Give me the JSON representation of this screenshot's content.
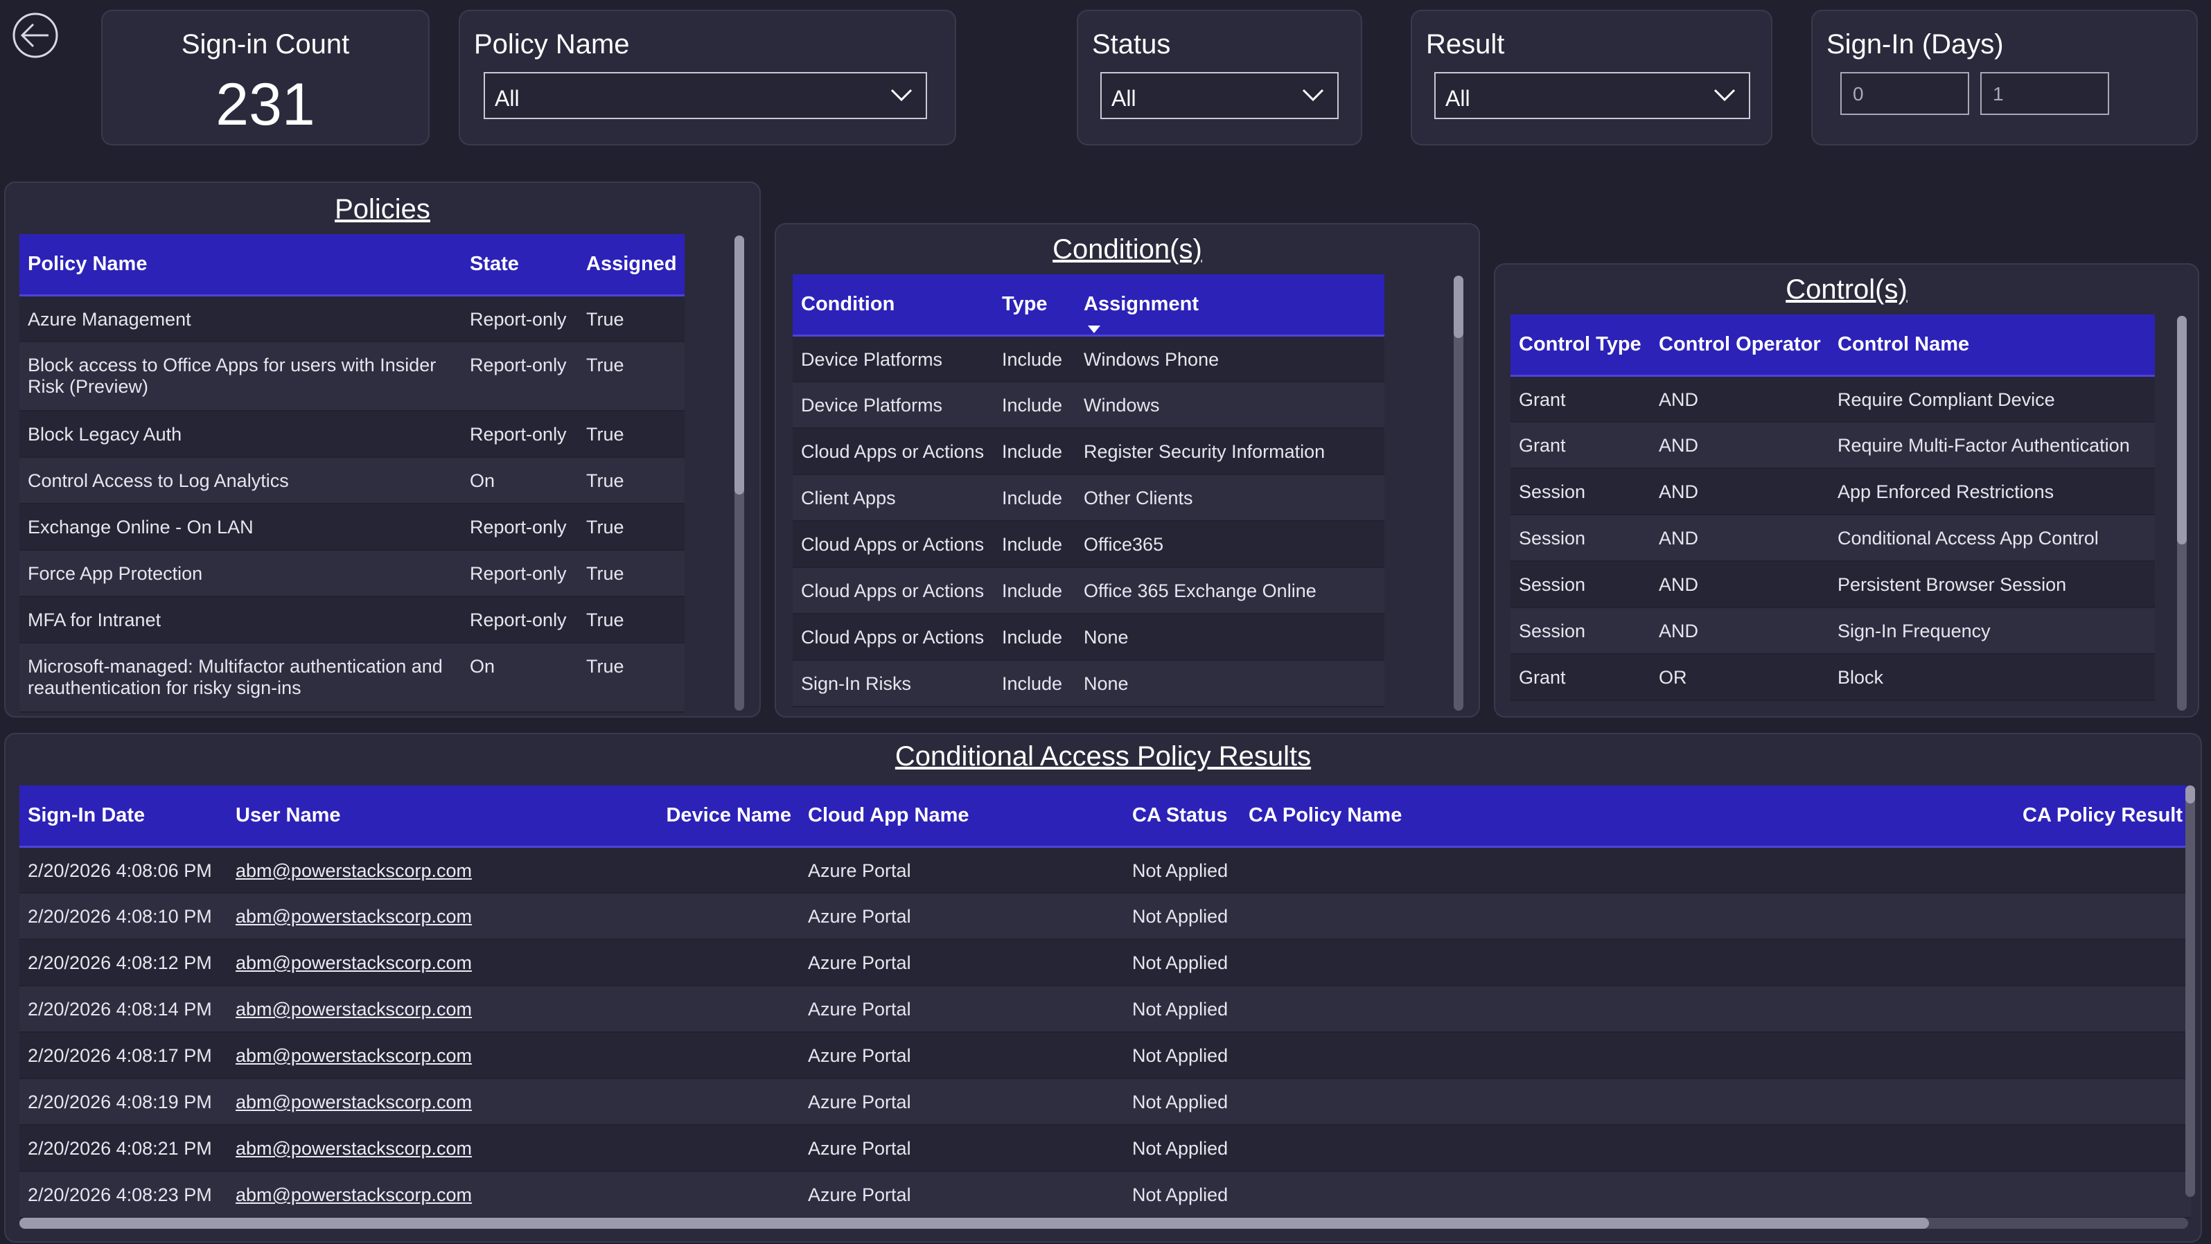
{
  "header": {
    "back_icon": "arrow-left-circle-icon",
    "sign_in_count": {
      "title": "Sign-in Count",
      "value": "231"
    },
    "policy_name_filter": {
      "title": "Policy Name",
      "selected": "All"
    },
    "status_filter": {
      "title": "Status",
      "selected": "All"
    },
    "result_filter": {
      "title": "Result",
      "selected": "All"
    },
    "sign_in_days": {
      "title": "Sign-In (Days)",
      "min": "0",
      "max": "1"
    }
  },
  "policies": {
    "title": "Policies",
    "columns": [
      "Policy Name",
      "State",
      "Assigned"
    ],
    "rows": [
      [
        "Azure Management",
        "Report-only",
        "True"
      ],
      [
        "Block access to Office Apps for users with Insider Risk (Preview)",
        "Report-only",
        "True"
      ],
      [
        "Block Legacy Auth",
        "Report-only",
        "True"
      ],
      [
        "Control Access to Log Analytics",
        "On",
        "True"
      ],
      [
        "Exchange Online - On LAN",
        "Report-only",
        "True"
      ],
      [
        "Force App Protection",
        "Report-only",
        "True"
      ],
      [
        "MFA for Intranet",
        "Report-only",
        "True"
      ],
      [
        "Microsoft-managed: Multifactor authentication and reauthentication for risky sign-ins",
        "On",
        "True"
      ]
    ]
  },
  "conditions": {
    "title": "Condition(s)",
    "columns": [
      "Condition",
      "Type",
      "Assignment"
    ],
    "rows": [
      [
        "Device Platforms",
        "Include",
        "Windows Phone"
      ],
      [
        "Device Platforms",
        "Include",
        "Windows"
      ],
      [
        "Cloud Apps or Actions",
        "Include",
        "Register Security Information"
      ],
      [
        "Client Apps",
        "Include",
        "Other Clients"
      ],
      [
        "Cloud Apps or Actions",
        "Include",
        "Office365"
      ],
      [
        "Cloud Apps or Actions",
        "Include",
        "Office 365 Exchange Online"
      ],
      [
        "Cloud Apps or Actions",
        "Include",
        "None"
      ],
      [
        "Sign-In Risks",
        "Include",
        "None"
      ]
    ]
  },
  "controls": {
    "title": "Control(s)",
    "columns": [
      "Control Type",
      "Control Operator",
      "Control Name"
    ],
    "rows": [
      [
        "Grant",
        "AND",
        "Require Compliant Device"
      ],
      [
        "Grant",
        "AND",
        "Require Multi-Factor Authentication"
      ],
      [
        "Session",
        "AND",
        "App Enforced Restrictions"
      ],
      [
        "Session",
        "AND",
        "Conditional Access App Control"
      ],
      [
        "Session",
        "AND",
        "Persistent Browser Session"
      ],
      [
        "Session",
        "AND",
        "Sign-In Frequency"
      ],
      [
        "Grant",
        "OR",
        "Block"
      ]
    ]
  },
  "results": {
    "title": "Conditional Access Policy Results",
    "columns": [
      "Sign-In Date",
      "User Name",
      "Device Name",
      "Cloud App Name",
      "CA Status",
      "CA Policy Name",
      "CA Policy Result"
    ],
    "rows": [
      [
        "2/20/2026 4:08:06 PM",
        "abm@powerstackscorp.com",
        "",
        "Azure Portal",
        "Not Applied",
        "",
        ""
      ],
      [
        "2/20/2026 4:08:10 PM",
        "abm@powerstackscorp.com",
        "",
        "Azure Portal",
        "Not Applied",
        "",
        ""
      ],
      [
        "2/20/2026 4:08:12 PM",
        "abm@powerstackscorp.com",
        "",
        "Azure Portal",
        "Not Applied",
        "",
        ""
      ],
      [
        "2/20/2026 4:08:14 PM",
        "abm@powerstackscorp.com",
        "",
        "Azure Portal",
        "Not Applied",
        "",
        ""
      ],
      [
        "2/20/2026 4:08:17 PM",
        "abm@powerstackscorp.com",
        "",
        "Azure Portal",
        "Not Applied",
        "",
        ""
      ],
      [
        "2/20/2026 4:08:19 PM",
        "abm@powerstackscorp.com",
        "",
        "Azure Portal",
        "Not Applied",
        "",
        ""
      ],
      [
        "2/20/2026 4:08:21 PM",
        "abm@powerstackscorp.com",
        "",
        "Azure Portal",
        "Not Applied",
        "",
        ""
      ],
      [
        "2/20/2026 4:08:23 PM",
        "abm@powerstackscorp.com",
        "",
        "Azure Portal",
        "Not Applied",
        "",
        ""
      ]
    ]
  },
  "colors": {
    "background": "#21202f",
    "card": "#2b2a3c",
    "header_accent": "#2c22b8",
    "text": "#ffffff"
  }
}
